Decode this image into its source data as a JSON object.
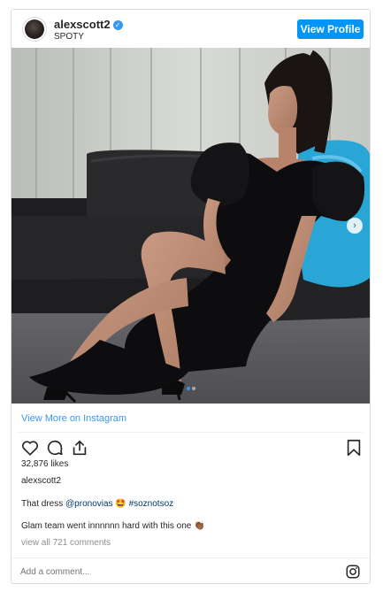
{
  "header": {
    "username": "alexscott2",
    "subtitle": "SPOTY",
    "verified_glyph": "✓",
    "view_profile_label": "View Profile"
  },
  "media": {
    "carousel_index": 0,
    "carousel_count": 2,
    "next_glyph": "›"
  },
  "links": {
    "view_more_label": "View More on Instagram"
  },
  "actions": {
    "icons": [
      "heart-icon",
      "comment-icon",
      "share-icon",
      "bookmark-icon"
    ]
  },
  "post": {
    "likes": "32,876 likes",
    "author": "alexscott2",
    "caption_text": "That dress ",
    "caption_mention": "@pronovias",
    "caption_emoji": "🤩",
    "caption_hashtag": "#soznotsoz",
    "caption2": "Glam team went innnnnn hard with this one 👏🏾",
    "view_comments": "view all 721 comments"
  },
  "comment": {
    "placeholder": "Add a comment..."
  },
  "colors": {
    "accent": "#0095f6",
    "link": "#3897f0",
    "border": "#dbdbdb",
    "muted": "#8e8e8e"
  }
}
